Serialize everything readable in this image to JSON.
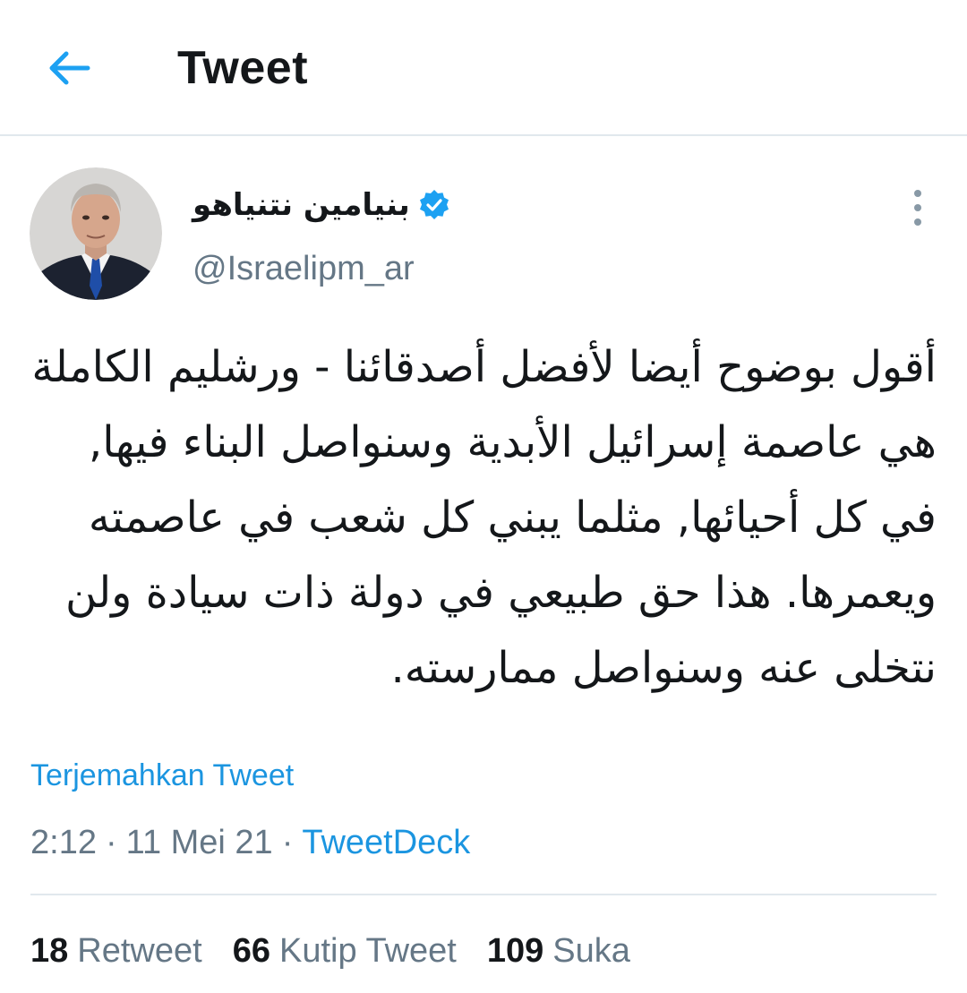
{
  "colors": {
    "accent": "#1da1f2",
    "link": "#1b95e0",
    "secondary_text": "#657786",
    "divider": "#e1e8ed"
  },
  "header": {
    "back_icon": "arrow-left-icon",
    "title": "Tweet"
  },
  "author": {
    "display_name": "بنيامين نتنياهو",
    "verified_icon": "verified-badge-icon",
    "handle": "@Israelipm_ar"
  },
  "more_icon": "more-vertical-icon",
  "tweet": {
    "text": "أقول بوضوح أيضا لأفضل أصدقائنا - ورشليم الكاملة هي عاصمة إسرائيل الأبدية وسنواصل البناء فيها, في كل أحيائها, مثلما يبني كل شعب في عاصمته ويعمرها. هذا حق طبيعي في دولة ذات سيادة ولن نتخلى عنه وسنواصل ممارسته."
  },
  "translate_label": "Terjemahkan Tweet",
  "meta": {
    "time": "2:12",
    "separator": "·",
    "date": "11 Mei 21",
    "source": "TweetDeck"
  },
  "stats": {
    "retweets_count": "18",
    "retweets_label": "Retweet",
    "quotes_count": "66",
    "quotes_label": "Kutip Tweet",
    "likes_count": "109",
    "likes_label": "Suka"
  }
}
